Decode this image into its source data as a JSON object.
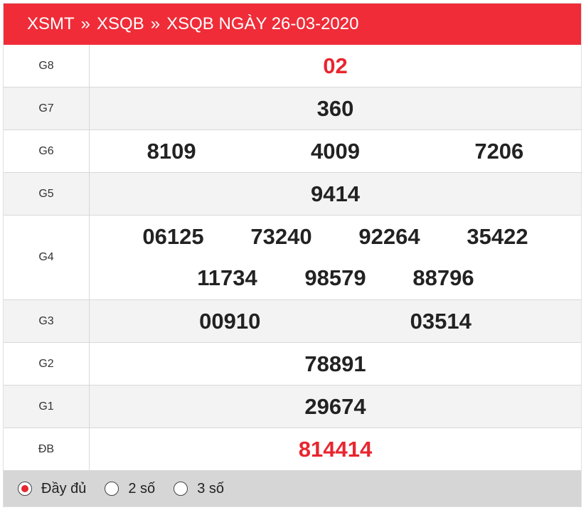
{
  "breadcrumb": {
    "items": [
      "XSMT",
      "XSQB",
      "XSQB NGÀY 26-03-2020"
    ],
    "separator": "»"
  },
  "prizes": {
    "g8": {
      "label": "G8",
      "values": [
        "02"
      ]
    },
    "g7": {
      "label": "G7",
      "values": [
        "360"
      ]
    },
    "g6": {
      "label": "G6",
      "values": [
        "8109",
        "4009",
        "7206"
      ]
    },
    "g5": {
      "label": "G5",
      "values": [
        "9414"
      ]
    },
    "g4": {
      "label": "G4",
      "values": [
        "06125",
        "73240",
        "92264",
        "35422",
        "11734",
        "98579",
        "88796"
      ]
    },
    "g3": {
      "label": "G3",
      "values": [
        "00910",
        "03514"
      ]
    },
    "g2": {
      "label": "G2",
      "values": [
        "78891"
      ]
    },
    "g1": {
      "label": "G1",
      "values": [
        "29674"
      ]
    },
    "db": {
      "label": "ĐB",
      "values": [
        "814414"
      ]
    }
  },
  "display_options": {
    "items": [
      "Đầy đủ",
      "2 số",
      "3 số"
    ],
    "selected": "Đầy đủ"
  },
  "colors": {
    "header_bg": "#ef2c38",
    "highlight_number": "#e8262f"
  }
}
